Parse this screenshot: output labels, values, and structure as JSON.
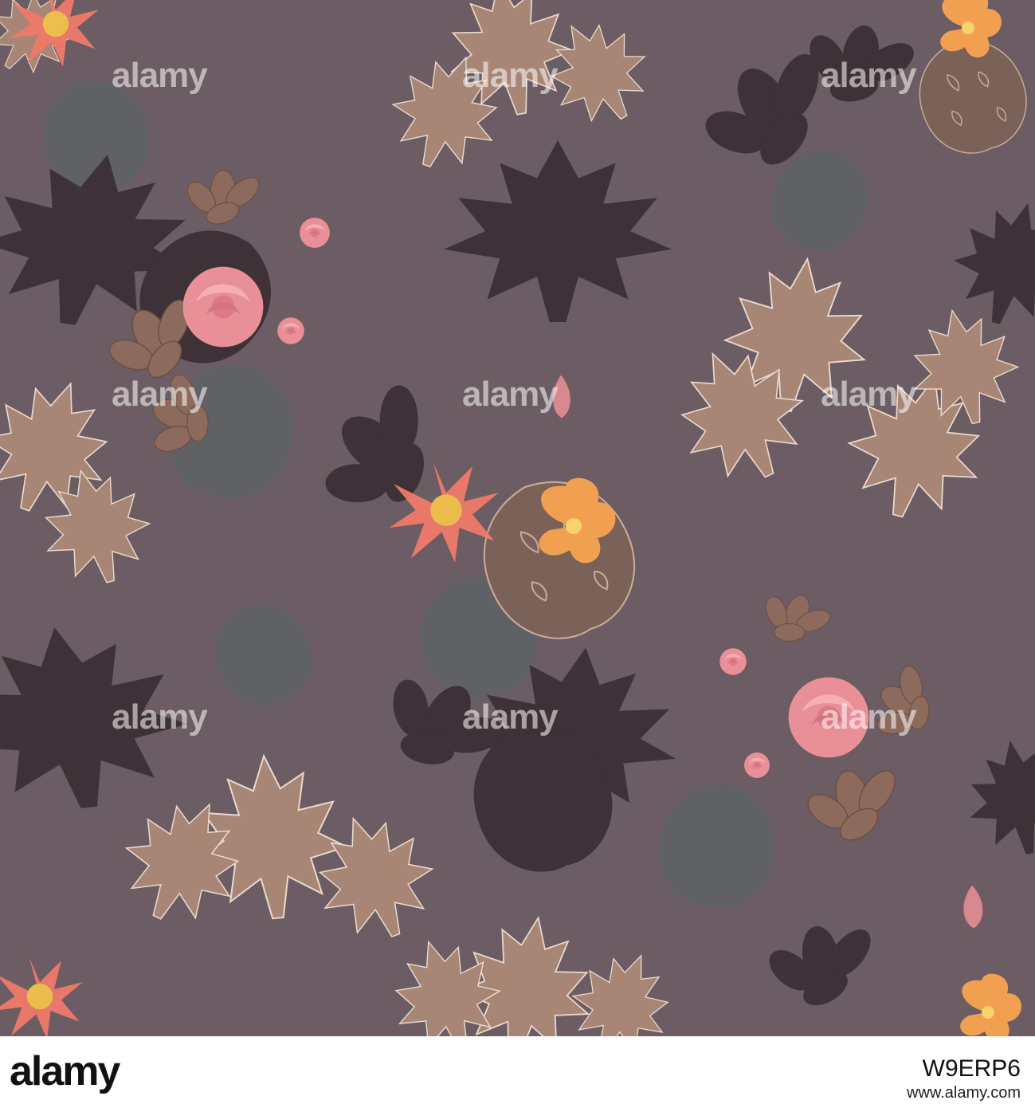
{
  "colors": {
    "background": "#6b5d63",
    "silhouette": "#3a2e34",
    "maple": "#a88676",
    "rose": "#e88f98",
    "lily": "#f07a6a",
    "hibiscus": "#f0a050",
    "monstera": "#7a6258",
    "teal_shadow": "#4f6a6a"
  },
  "watermark": {
    "text": "alamy"
  },
  "footer": {
    "logo": "alamy",
    "image_id": "W9ERP6",
    "site": "www.alamy.com"
  }
}
